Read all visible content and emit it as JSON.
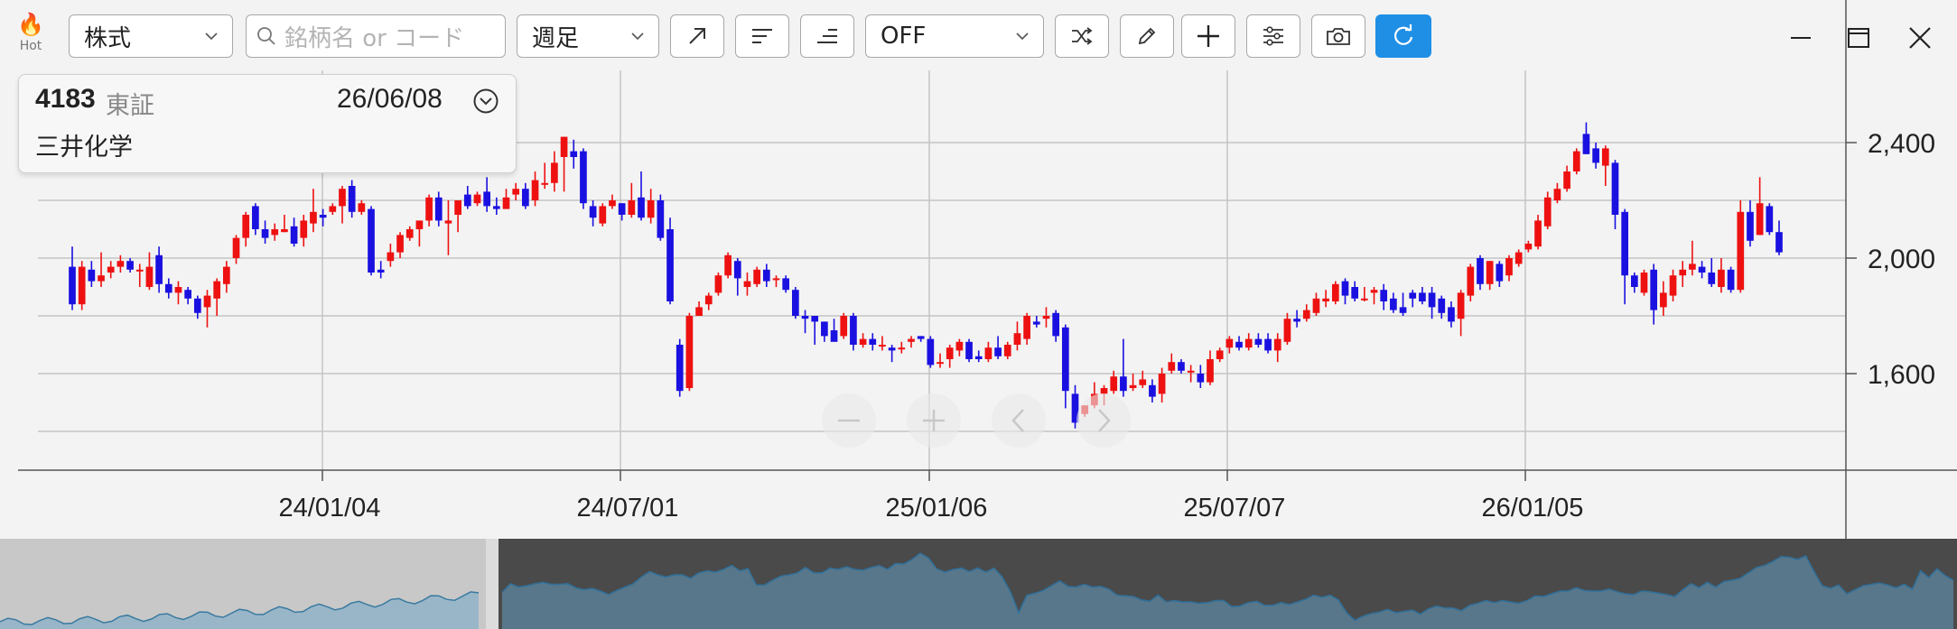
{
  "toolbar": {
    "hot_label": "Hot",
    "market_select": "株式",
    "search_placeholder": "銘柄名 or コード",
    "period_select": "週足",
    "indicator_select": "OFF",
    "icons": [
      "trend-line-icon",
      "align-left-icon",
      "align-right-icon",
      "shuffle-icon",
      "pencil-icon",
      "plus-icon",
      "sliders-icon",
      "camera-icon",
      "refresh-icon"
    ],
    "accent_color": "#1f8fe6"
  },
  "window": {
    "icons": [
      "minimize-icon",
      "maximize-icon",
      "close-icon"
    ]
  },
  "info": {
    "code": "4183",
    "exchange": "東証",
    "date": "26/06/08",
    "name": "三井化学"
  },
  "chart_data": {
    "type": "candlestick",
    "up_color": "#ee1111",
    "down_color": "#1a10e0",
    "y_ticks": [
      "1,600",
      "2,000",
      "2,400"
    ],
    "y_tick_values": [
      1600,
      2000,
      2400
    ],
    "ylim": [
      1300,
      2500
    ],
    "x_ticks": [
      "24/01/04",
      "24/07/01",
      "25/01/06",
      "25/07/07",
      "26/01/05"
    ],
    "grid": true,
    "candles": [
      [
        1970,
        1840,
        2040,
        1820
      ],
      [
        1840,
        1970,
        1990,
        1820
      ],
      [
        1960,
        1920,
        1990,
        1900
      ],
      [
        1920,
        1940,
        2020,
        1900
      ],
      [
        1950,
        1970,
        1990,
        1930
      ],
      [
        1970,
        1990,
        2010,
        1950
      ],
      [
        1990,
        1960,
        2000,
        1950
      ],
      [
        1960,
        1960,
        1980,
        1900
      ],
      [
        1900,
        1970,
        2020,
        1890
      ],
      [
        2010,
        1910,
        2040,
        1880
      ],
      [
        1910,
        1880,
        1930,
        1860
      ],
      [
        1880,
        1900,
        1920,
        1840
      ],
      [
        1890,
        1860,
        1900,
        1840
      ],
      [
        1860,
        1810,
        1870,
        1790
      ],
      [
        1830,
        1870,
        1890,
        1760
      ],
      [
        1860,
        1920,
        1930,
        1800
      ],
      [
        1910,
        1970,
        1990,
        1880
      ],
      [
        2000,
        2070,
        2080,
        1980
      ],
      [
        2070,
        2150,
        2160,
        2040
      ],
      [
        2180,
        2100,
        2190,
        2080
      ],
      [
        2100,
        2070,
        2130,
        2050
      ],
      [
        2080,
        2100,
        2120,
        2060
      ],
      [
        2090,
        2100,
        2150,
        2090
      ],
      [
        2110,
        2050,
        2140,
        2040
      ],
      [
        2070,
        2130,
        2150,
        2040
      ],
      [
        2120,
        2160,
        2240,
        2090
      ],
      [
        2150,
        2140,
        2170,
        2110
      ],
      [
        2160,
        2180,
        2190,
        2150
      ],
      [
        2180,
        2240,
        2250,
        2120
      ],
      [
        2250,
        2160,
        2270,
        2140
      ],
      [
        2160,
        2190,
        2200,
        2150
      ],
      [
        2170,
        1950,
        2180,
        1940
      ],
      [
        1960,
        1950,
        1990,
        1930
      ],
      [
        1990,
        2020,
        2050,
        1970
      ],
      [
        2020,
        2080,
        2090,
        2000
      ],
      [
        2070,
        2100,
        2110,
        2060
      ],
      [
        2100,
        2130,
        2130,
        2040
      ],
      [
        2130,
        2210,
        2220,
        2110
      ],
      [
        2210,
        2130,
        2230,
        2110
      ],
      [
        2120,
        2130,
        2200,
        2010
      ],
      [
        2150,
        2200,
        2200,
        2090
      ],
      [
        2220,
        2180,
        2250,
        2170
      ],
      [
        2190,
        2220,
        2230,
        2180
      ],
      [
        2230,
        2180,
        2280,
        2160
      ],
      [
        2180,
        2170,
        2210,
        2150
      ],
      [
        2170,
        2210,
        2240,
        2170
      ],
      [
        2220,
        2240,
        2260,
        2200
      ],
      [
        2240,
        2180,
        2260,
        2170
      ],
      [
        2200,
        2270,
        2300,
        2180
      ],
      [
        2260,
        2260,
        2330,
        2240
      ],
      [
        2260,
        2330,
        2370,
        2230
      ],
      [
        2350,
        2420,
        2420,
        2230
      ],
      [
        2370,
        2350,
        2410,
        2310
      ],
      [
        2370,
        2190,
        2380,
        2170
      ],
      [
        2180,
        2140,
        2200,
        2110
      ],
      [
        2120,
        2180,
        2190,
        2110
      ],
      [
        2180,
        2200,
        2220,
        2170
      ],
      [
        2190,
        2150,
        2190,
        2130
      ],
      [
        2150,
        2200,
        2260,
        2140
      ],
      [
        2210,
        2140,
        2300,
        2130
      ],
      [
        2140,
        2200,
        2240,
        2120
      ],
      [
        2200,
        2070,
        2220,
        2060
      ],
      [
        2100,
        1850,
        2140,
        1840
      ],
      [
        1700,
        1540,
        1720,
        1520
      ],
      [
        1550,
        1800,
        1810,
        1540
      ],
      [
        1800,
        1830,
        1850,
        1800
      ],
      [
        1840,
        1870,
        1880,
        1820
      ],
      [
        1880,
        1940,
        1950,
        1870
      ],
      [
        1940,
        2010,
        2020,
        1930
      ],
      [
        1990,
        1930,
        2000,
        1870
      ],
      [
        1900,
        1920,
        1950,
        1870
      ],
      [
        1910,
        1960,
        1970,
        1900
      ],
      [
        1960,
        1920,
        1980,
        1900
      ],
      [
        1930,
        1930,
        1940,
        1900
      ],
      [
        1930,
        1890,
        1940,
        1880
      ],
      [
        1890,
        1800,
        1900,
        1790
      ],
      [
        1800,
        1790,
        1820,
        1740
      ],
      [
        1800,
        1780,
        1790,
        1700
      ],
      [
        1780,
        1730,
        1780,
        1710
      ],
      [
        1750,
        1710,
        1790,
        1720
      ],
      [
        1730,
        1800,
        1810,
        1720
      ],
      [
        1800,
        1700,
        1810,
        1680
      ],
      [
        1700,
        1720,
        1740,
        1690
      ],
      [
        1720,
        1700,
        1740,
        1680
      ],
      [
        1700,
        1700,
        1730,
        1680
      ],
      [
        1690,
        1680,
        1700,
        1640
      ],
      [
        1690,
        1690,
        1710,
        1670
      ],
      [
        1710,
        1720,
        1730,
        1690
      ],
      [
        1730,
        1720,
        1730,
        1710
      ],
      [
        1720,
        1630,
        1730,
        1620
      ],
      [
        1640,
        1640,
        1670,
        1620
      ],
      [
        1650,
        1690,
        1700,
        1620
      ],
      [
        1680,
        1710,
        1720,
        1660
      ],
      [
        1710,
        1650,
        1720,
        1640
      ],
      [
        1660,
        1650,
        1680,
        1640
      ],
      [
        1650,
        1690,
        1710,
        1640
      ],
      [
        1690,
        1660,
        1730,
        1650
      ],
      [
        1660,
        1700,
        1710,
        1650
      ],
      [
        1700,
        1740,
        1780,
        1680
      ],
      [
        1720,
        1800,
        1810,
        1700
      ],
      [
        1780,
        1770,
        1800,
        1760
      ],
      [
        1790,
        1800,
        1830,
        1760
      ],
      [
        1810,
        1730,
        1820,
        1710
      ],
      [
        1760,
        1540,
        1770,
        1480
      ],
      [
        1530,
        1430,
        1560,
        1410
      ],
      [
        1460,
        1490,
        1490,
        1450
      ],
      [
        1490,
        1530,
        1570,
        1480
      ],
      [
        1530,
        1550,
        1560,
        1490
      ],
      [
        1540,
        1590,
        1610,
        1530
      ],
      [
        1590,
        1540,
        1720,
        1520
      ],
      [
        1550,
        1560,
        1600,
        1540
      ],
      [
        1560,
        1580,
        1610,
        1550
      ],
      [
        1560,
        1520,
        1580,
        1500
      ],
      [
        1530,
        1600,
        1620,
        1500
      ],
      [
        1610,
        1640,
        1670,
        1600
      ],
      [
        1640,
        1610,
        1650,
        1600
      ],
      [
        1610,
        1610,
        1630,
        1570
      ],
      [
        1600,
        1570,
        1630,
        1550
      ],
      [
        1570,
        1650,
        1680,
        1560
      ],
      [
        1650,
        1680,
        1690,
        1640
      ],
      [
        1690,
        1720,
        1730,
        1670
      ],
      [
        1710,
        1690,
        1730,
        1680
      ],
      [
        1690,
        1720,
        1740,
        1680
      ],
      [
        1720,
        1700,
        1740,
        1690
      ],
      [
        1720,
        1680,
        1740,
        1670
      ],
      [
        1680,
        1720,
        1740,
        1640
      ],
      [
        1710,
        1790,
        1810,
        1700
      ],
      [
        1790,
        1780,
        1820,
        1760
      ],
      [
        1790,
        1820,
        1840,
        1780
      ],
      [
        1810,
        1860,
        1880,
        1800
      ],
      [
        1850,
        1860,
        1890,
        1830
      ],
      [
        1850,
        1910,
        1920,
        1840
      ],
      [
        1920,
        1870,
        1930,
        1840
      ],
      [
        1900,
        1860,
        1920,
        1850
      ],
      [
        1860,
        1860,
        1900,
        1850
      ],
      [
        1880,
        1890,
        1900,
        1840
      ],
      [
        1890,
        1850,
        1910,
        1820
      ],
      [
        1860,
        1820,
        1880,
        1810
      ],
      [
        1830,
        1810,
        1880,
        1800
      ],
      [
        1880,
        1860,
        1890,
        1830
      ],
      [
        1880,
        1850,
        1900,
        1840
      ],
      [
        1880,
        1830,
        1900,
        1790
      ],
      [
        1860,
        1810,
        1870,
        1790
      ],
      [
        1830,
        1780,
        1850,
        1760
      ],
      [
        1790,
        1880,
        1890,
        1730
      ],
      [
        1870,
        1970,
        1980,
        1850
      ],
      [
        2000,
        1910,
        2010,
        1890
      ],
      [
        1910,
        1990,
        1990,
        1890
      ],
      [
        1980,
        1920,
        1990,
        1900
      ],
      [
        1940,
        2000,
        2010,
        1920
      ],
      [
        1980,
        2020,
        2030,
        1970
      ],
      [
        2030,
        2050,
        2060,
        2020
      ],
      [
        2040,
        2130,
        2150,
        2030
      ],
      [
        2110,
        2210,
        2230,
        2100
      ],
      [
        2200,
        2240,
        2260,
        2190
      ],
      [
        2240,
        2300,
        2320,
        2230
      ],
      [
        2300,
        2370,
        2380,
        2290
      ],
      [
        2430,
        2360,
        2470,
        2360
      ],
      [
        2380,
        2330,
        2400,
        2310
      ],
      [
        2320,
        2380,
        2390,
        2250
      ],
      [
        2330,
        2150,
        2340,
        2100
      ],
      [
        2160,
        1940,
        2170,
        1840
      ],
      [
        1940,
        1900,
        1950,
        1880
      ],
      [
        1880,
        1950,
        1960,
        1870
      ],
      [
        1960,
        1820,
        1980,
        1770
      ],
      [
        1830,
        1880,
        1920,
        1800
      ],
      [
        1870,
        1940,
        1960,
        1850
      ],
      [
        1940,
        1960,
        1990,
        1900
      ],
      [
        1960,
        1980,
        2060,
        1940
      ],
      [
        1970,
        1950,
        1990,
        1930
      ],
      [
        1950,
        1910,
        2000,
        1900
      ],
      [
        1900,
        1960,
        2000,
        1880
      ],
      [
        1960,
        1890,
        1970,
        1880
      ],
      [
        1890,
        2160,
        2200,
        1880
      ],
      [
        2160,
        2060,
        2200,
        2040
      ],
      [
        2080,
        2190,
        2280,
        2080
      ],
      [
        2180,
        2090,
        2190,
        2080
      ],
      [
        2090,
        2020,
        2130,
        2010
      ]
    ],
    "navigator": {
      "left_fill": "#c8c8c8",
      "right_fill": "#4a4a4a"
    }
  }
}
